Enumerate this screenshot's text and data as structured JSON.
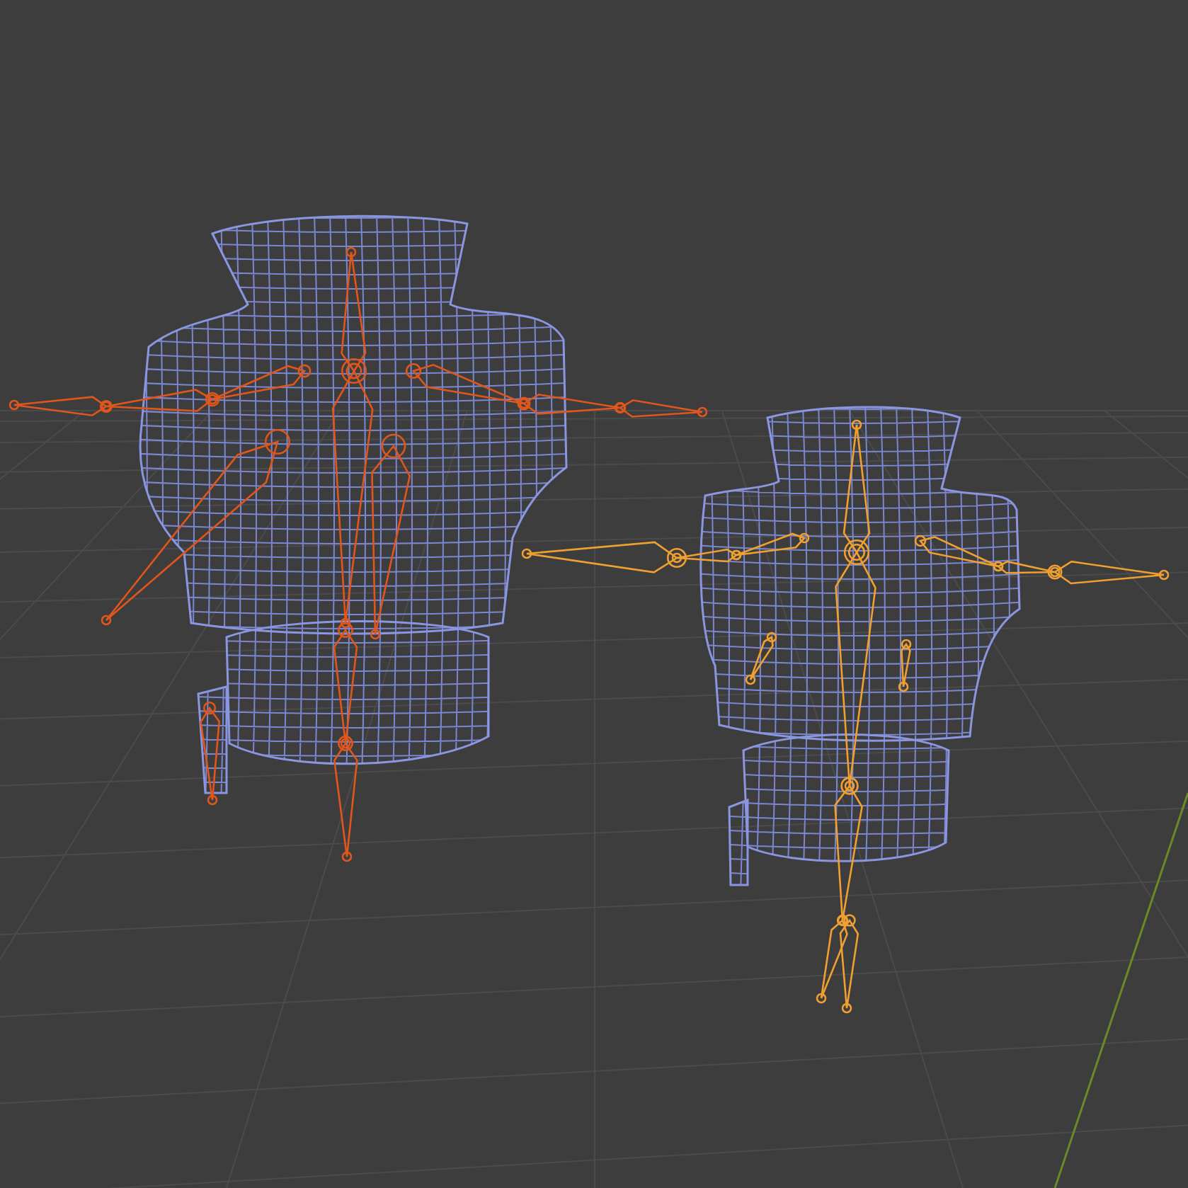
{
  "viewport": {
    "armatures": [
      {
        "color": "#e0561c"
      },
      {
        "color": "#f0a030"
      }
    ]
  }
}
